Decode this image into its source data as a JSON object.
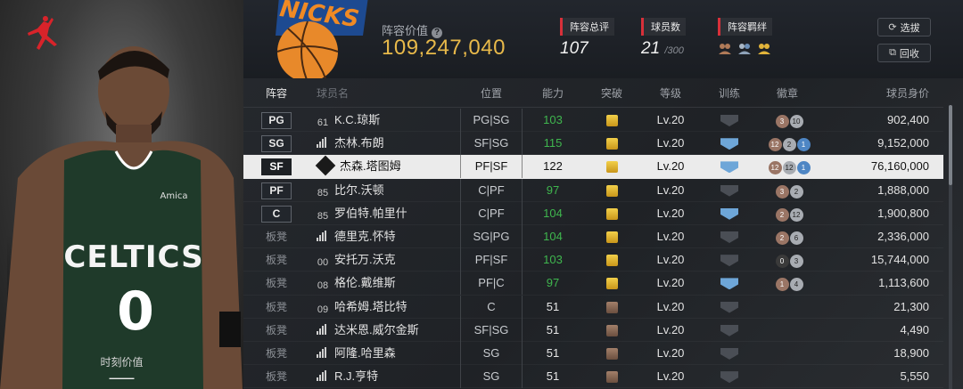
{
  "player": {
    "moment_label": "时刻价值",
    "moment_value": "——"
  },
  "header": {
    "lineup_value_label": "阵容价值",
    "lineup_value": "109,247,040",
    "stats": {
      "rating_label": "阵容总评",
      "rating_value": "107",
      "count_label": "球员数",
      "count_value": "21",
      "count_max": "/300",
      "bond_label": "阵容羁绊"
    },
    "buttons": {
      "select": "选拔",
      "recycle": "回收"
    }
  },
  "table": {
    "headers": {
      "lineup": "阵容",
      "name": "球员名",
      "position": "位置",
      "overall": "能力",
      "breakthrough": "突破",
      "level": "等级",
      "training": "训练",
      "badges": "徽章",
      "price": "球员身价"
    },
    "rows": [
      {
        "lineup": "PG",
        "num": "61",
        "name": "K.C.琼斯",
        "pos": "PG|SG",
        "ovr": "103",
        "level": "Lv.20",
        "price": "902,400",
        "badges": [
          "3",
          "10"
        ]
      },
      {
        "lineup": "SG",
        "num": "",
        "name": "杰林.布朗",
        "pos": "SF|SG",
        "ovr": "115",
        "level": "Lv.20",
        "price": "9,152,000",
        "badges": [
          "12",
          "2",
          "1"
        ]
      },
      {
        "lineup": "SF",
        "num": "",
        "name": "杰森.塔图姆",
        "pos": "PF|SF",
        "ovr": "122",
        "level": "Lv.20",
        "price": "76,160,000",
        "badges": [
          "12",
          "12",
          "1"
        ]
      },
      {
        "lineup": "PF",
        "num": "85",
        "name": "比尔.沃顿",
        "pos": "C|PF",
        "ovr": "97",
        "level": "Lv.20",
        "price": "1,888,000",
        "badges": [
          "3",
          "2"
        ]
      },
      {
        "lineup": "C",
        "num": "85",
        "name": "罗伯特.帕里什",
        "pos": "C|PF",
        "ovr": "104",
        "level": "Lv.20",
        "price": "1,900,800",
        "badges": [
          "2",
          "12"
        ]
      },
      {
        "lineup": "板凳",
        "num": "",
        "name": "德里克.怀特",
        "pos": "SG|PG",
        "ovr": "104",
        "level": "Lv.20",
        "price": "2,336,000",
        "badges": [
          "2",
          "6"
        ]
      },
      {
        "lineup": "板凳",
        "num": "00",
        "name": "安托万.沃克",
        "pos": "PF|SF",
        "ovr": "103",
        "level": "Lv.20",
        "price": "15,744,000",
        "badges": [
          "0",
          "3"
        ]
      },
      {
        "lineup": "板凳",
        "num": "08",
        "name": "格伦.戴维斯",
        "pos": "PF|C",
        "ovr": "97",
        "level": "Lv.20",
        "price": "1,113,600",
        "badges": [
          "1",
          "4"
        ]
      },
      {
        "lineup": "板凳",
        "num": "09",
        "name": "哈希姆.塔比特",
        "pos": "C",
        "ovr": "51",
        "level": "Lv.20",
        "price": "21,300",
        "badges": []
      },
      {
        "lineup": "板凳",
        "num": "",
        "name": "达米恩.威尔金斯",
        "pos": "SF|SG",
        "ovr": "51",
        "level": "Lv.20",
        "price": "4,490",
        "badges": []
      },
      {
        "lineup": "板凳",
        "num": "",
        "name": "阿隆.哈里森",
        "pos": "SG",
        "ovr": "51",
        "level": "Lv.20",
        "price": "18,900",
        "badges": []
      },
      {
        "lineup": "板凳",
        "num": "",
        "name": "R.J.亨特",
        "pos": "SG",
        "ovr": "51",
        "level": "Lv.20",
        "price": "5,550",
        "badges": []
      }
    ]
  },
  "colors": {
    "accent_gold": "#e8b94a",
    "green_ovr": "#3fb64e",
    "active_row": "#ebebeb",
    "stat_tag_red": "#d8303a"
  }
}
